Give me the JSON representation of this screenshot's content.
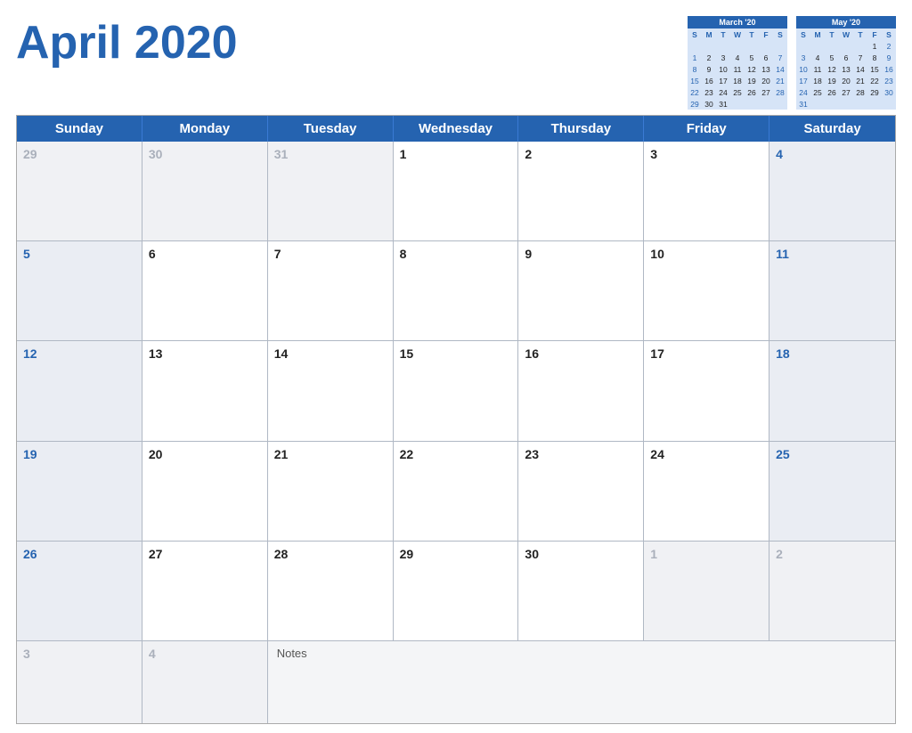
{
  "title": "April 2020",
  "mini_cals": [
    {
      "title": "March '20",
      "days_header": [
        "S",
        "M",
        "T",
        "W",
        "T",
        "F",
        "S"
      ],
      "weeks": [
        [
          "",
          "",
          "",
          "",
          "",
          "",
          ""
        ],
        [
          "1",
          "2",
          "3",
          "4",
          "5",
          "6",
          "7"
        ],
        [
          "8",
          "9",
          "10",
          "11",
          "12",
          "13",
          "14"
        ],
        [
          "15",
          "16",
          "17",
          "18",
          "19",
          "20",
          "21"
        ],
        [
          "22",
          "23",
          "24",
          "25",
          "26",
          "27",
          "28"
        ],
        [
          "29",
          "30",
          "31",
          "",
          "",
          "",
          ""
        ]
      ]
    },
    {
      "title": "May '20",
      "days_header": [
        "S",
        "M",
        "T",
        "W",
        "T",
        "F",
        "S"
      ],
      "weeks": [
        [
          "",
          "",
          "",
          "",
          "",
          "1",
          "2"
        ],
        [
          "3",
          "4",
          "5",
          "6",
          "7",
          "8",
          "9"
        ],
        [
          "10",
          "11",
          "12",
          "13",
          "14",
          "15",
          "16"
        ],
        [
          "17",
          "18",
          "19",
          "20",
          "21",
          "22",
          "23"
        ],
        [
          "24",
          "25",
          "26",
          "27",
          "28",
          "29",
          "30"
        ],
        [
          "31",
          "",
          "",
          "",
          "",
          "",
          ""
        ]
      ]
    }
  ],
  "header_days": [
    "Sunday",
    "Monday",
    "Tuesday",
    "Wednesday",
    "Thursday",
    "Friday",
    "Saturday"
  ],
  "weeks": [
    [
      {
        "num": "29",
        "type": "other"
      },
      {
        "num": "30",
        "type": "other"
      },
      {
        "num": "31",
        "type": "other"
      },
      {
        "num": "1",
        "type": "current"
      },
      {
        "num": "2",
        "type": "current"
      },
      {
        "num": "3",
        "type": "current"
      },
      {
        "num": "4",
        "type": "sat"
      }
    ],
    [
      {
        "num": "5",
        "type": "sun"
      },
      {
        "num": "6",
        "type": "current"
      },
      {
        "num": "7",
        "type": "current"
      },
      {
        "num": "8",
        "type": "current"
      },
      {
        "num": "9",
        "type": "current"
      },
      {
        "num": "10",
        "type": "current"
      },
      {
        "num": "11",
        "type": "sat"
      }
    ],
    [
      {
        "num": "12",
        "type": "sun"
      },
      {
        "num": "13",
        "type": "current"
      },
      {
        "num": "14",
        "type": "current"
      },
      {
        "num": "15",
        "type": "current"
      },
      {
        "num": "16",
        "type": "current"
      },
      {
        "num": "17",
        "type": "current"
      },
      {
        "num": "18",
        "type": "sat"
      }
    ],
    [
      {
        "num": "19",
        "type": "sun"
      },
      {
        "num": "20",
        "type": "current"
      },
      {
        "num": "21",
        "type": "current"
      },
      {
        "num": "22",
        "type": "current"
      },
      {
        "num": "23",
        "type": "current"
      },
      {
        "num": "24",
        "type": "current"
      },
      {
        "num": "25",
        "type": "sat"
      }
    ],
    [
      {
        "num": "26",
        "type": "sun"
      },
      {
        "num": "27",
        "type": "current"
      },
      {
        "num": "28",
        "type": "current"
      },
      {
        "num": "29",
        "type": "current"
      },
      {
        "num": "30",
        "type": "current"
      },
      {
        "num": "1",
        "type": "other"
      },
      {
        "num": "2",
        "type": "other-sat"
      }
    ]
  ],
  "last_row": [
    {
      "num": "3",
      "type": "other"
    },
    {
      "num": "4",
      "type": "other"
    },
    {
      "num": "notes",
      "type": "notes"
    }
  ],
  "notes_label": "Notes"
}
